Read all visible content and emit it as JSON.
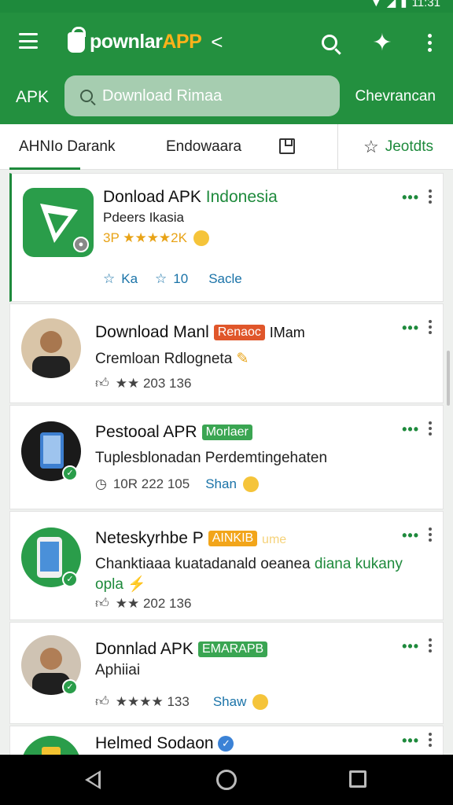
{
  "status": {
    "time": "11:31"
  },
  "appbar": {
    "logo_main": "pownlar",
    "logo_accent": "APP",
    "logo_chevron": "<"
  },
  "searchrow": {
    "left_label": "APK",
    "placeholder": "Download Rimaa",
    "right_label": "Chevrancan"
  },
  "tabs": {
    "active": "AHNIo Darank",
    "second": "Endowaara",
    "right": "Jeotdts"
  },
  "colors": {
    "primary": "#23903f",
    "accent": "#ffb21a",
    "link": "#1a73a8"
  },
  "cards": [
    {
      "title": "Donload APK",
      "title_green": "Indonesia",
      "subtitle": "Pdeers Ikasia",
      "rating_text": "3P ★★★★2K",
      "actions": [
        "Ka",
        "10",
        "Sacle"
      ]
    },
    {
      "title": "Download Manl",
      "badge": "Renaoc",
      "title_suffix": "IMam",
      "subtitle": "Cremloan Rdlogneta",
      "meta": "★★ 203 136"
    },
    {
      "title": "Pestooal APR",
      "badge": "Morlaer",
      "subtitle": "Tuplesblonadan Perdemtingehaten",
      "meta_1": "10R 222 105",
      "meta_share": "Shan"
    },
    {
      "title": "Neteskyrhbe P",
      "badge": "AINKIB",
      "badge_suffix": "ume",
      "subtitle": "Chanktiaaa kuatadanald oeanea",
      "subtitle_green": "diana kukany",
      "subtitle_line2": "opla",
      "meta": "★★ 202 136"
    },
    {
      "title": "Donnlad APK",
      "badge": "EMARAPB",
      "subtitle": "Aphiiai",
      "meta": "★★★★ 133",
      "meta_share": "Shaw"
    },
    {
      "title": "Helmed Sodaon"
    }
  ]
}
